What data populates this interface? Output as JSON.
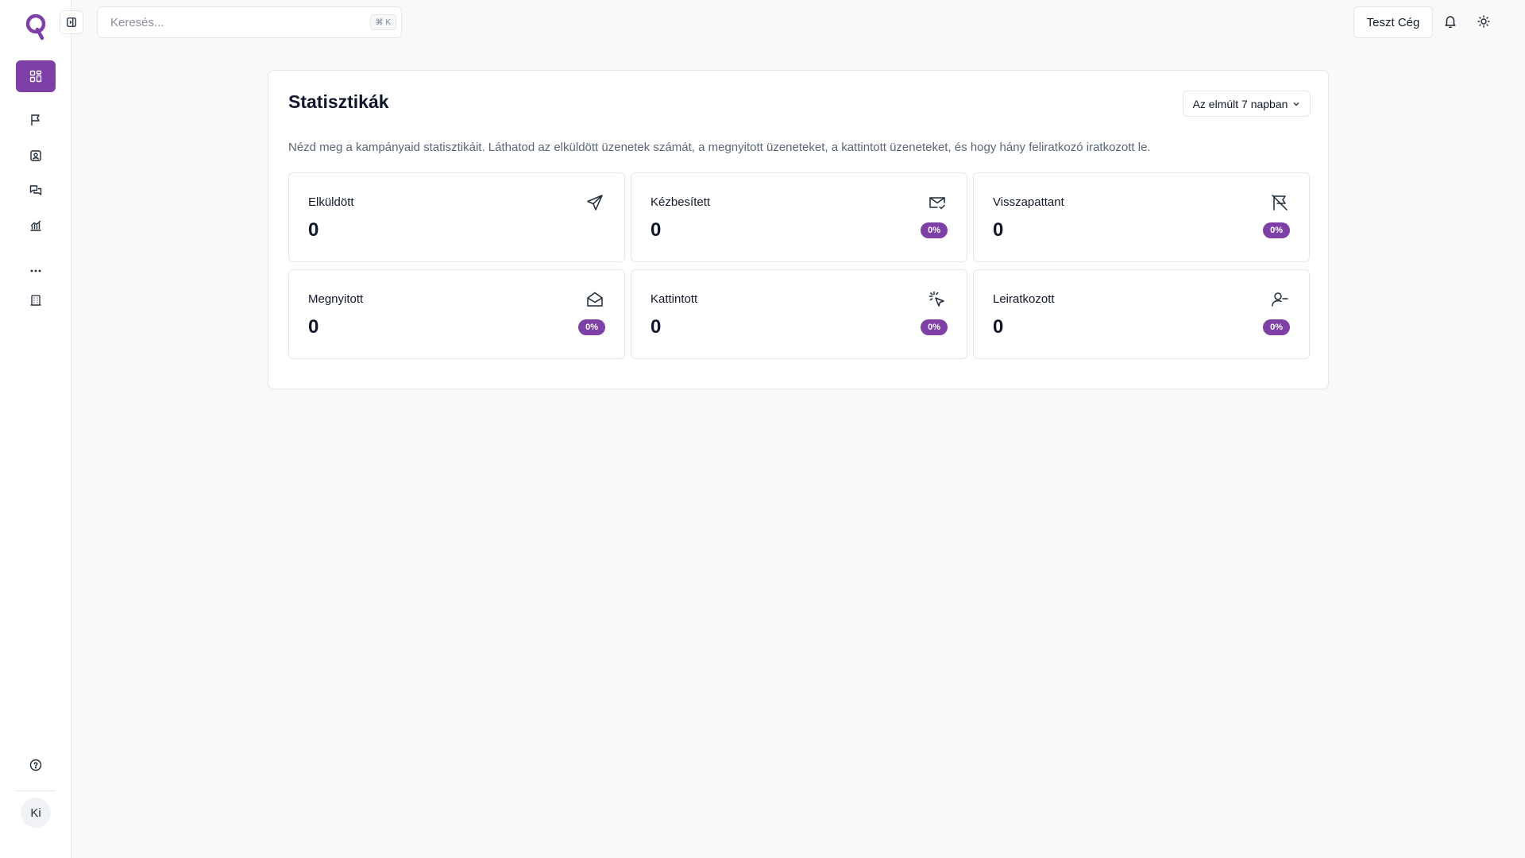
{
  "colors": {
    "accent": "#7e3fa6",
    "border": "#e5e7eb",
    "background": "#f9f9fa"
  },
  "sidebar": {
    "items": [
      {
        "icon": "dashboard-icon",
        "active": true
      },
      {
        "icon": "flag-icon",
        "active": false
      },
      {
        "icon": "contacts-icon",
        "active": false
      },
      {
        "icon": "messages-icon",
        "active": false
      },
      {
        "icon": "analytics-icon",
        "active": false
      },
      {
        "icon": "more-icon",
        "active": false
      },
      {
        "icon": "building-icon",
        "active": false
      }
    ],
    "help_icon": "help-circle-icon",
    "avatar_initials": "Ki"
  },
  "topbar": {
    "search_placeholder": "Keresés...",
    "search_shortcut": "⌘ K",
    "company_label": "Teszt Cég",
    "notification_icon": "bell-icon",
    "theme_icon": "sun-icon"
  },
  "stats_card": {
    "title": "Statisztikák",
    "range_label": "Az elmúlt 7 napban",
    "description": "Nézd meg a kampányaid statisztikáit. Láthatod az elküldött üzenetek számát, a megnyitott üzeneteket, a kattintott üzeneteket, és hogy hány feliratkozó iratkozott le.",
    "items": [
      {
        "label": "Elküldött",
        "value": "0",
        "badge": null,
        "icon": "send-icon"
      },
      {
        "label": "Kézbesített",
        "value": "0",
        "badge": "0%",
        "icon": "mail-check-icon"
      },
      {
        "label": "Visszapattant",
        "value": "0",
        "badge": "0%",
        "icon": "flag-off-icon"
      },
      {
        "label": "Megnyitott",
        "value": "0",
        "badge": "0%",
        "icon": "mail-open-icon"
      },
      {
        "label": "Kattintott",
        "value": "0",
        "badge": "0%",
        "icon": "pointer-click-icon"
      },
      {
        "label": "Leiratkozott",
        "value": "0",
        "badge": "0%",
        "icon": "user-minus-icon"
      }
    ]
  }
}
